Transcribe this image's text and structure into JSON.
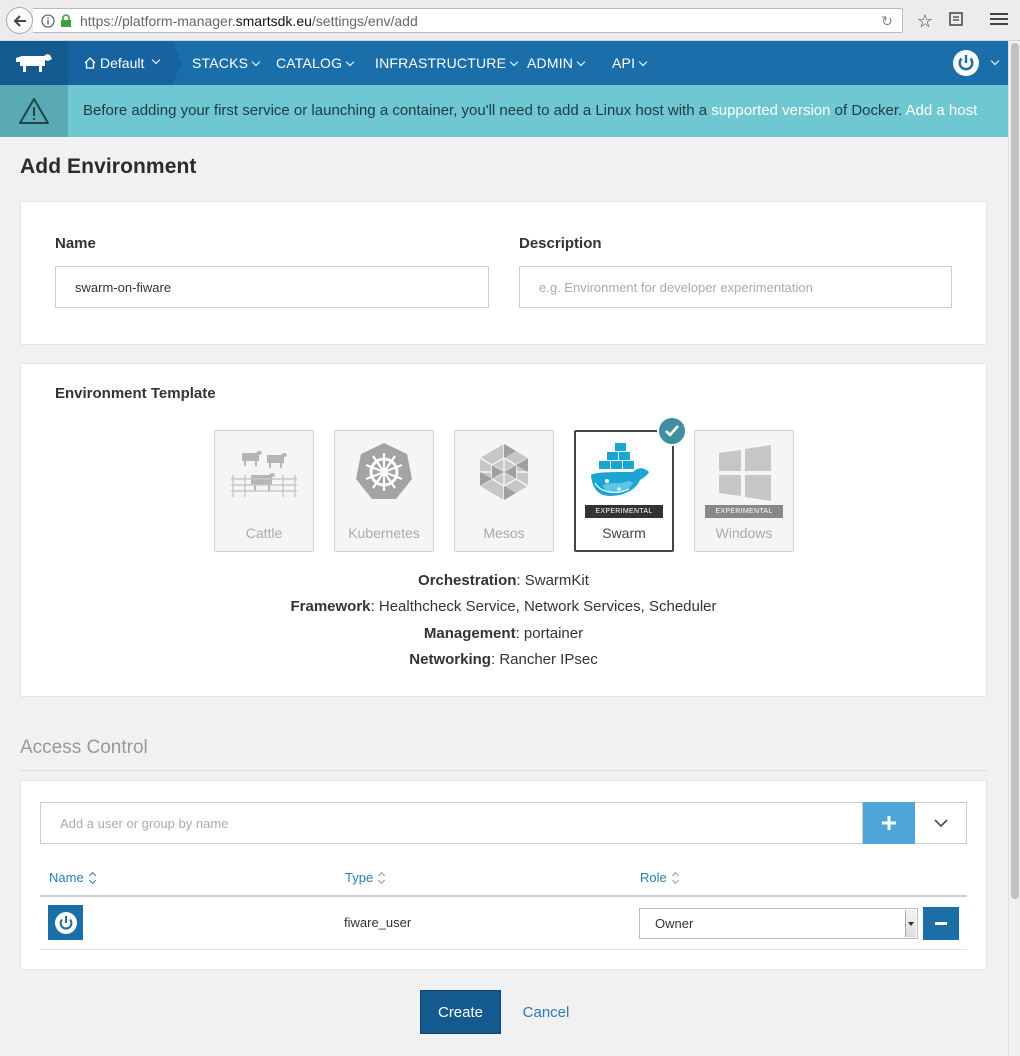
{
  "browser": {
    "url_prefix": "https://platform-manager.",
    "url_domain": "smartsdk.eu",
    "url_path": "/settings/env/add"
  },
  "header": {
    "env_label": "Default",
    "nav": [
      "STACKS",
      "CATALOG",
      "INFRASTRUCTURE",
      "ADMIN",
      "API"
    ]
  },
  "banner": {
    "text_before": "Before adding your first service or launching a container, you'll need to add a Linux host with a ",
    "link_supported": "supported version",
    "text_mid": " of Docker. ",
    "link_add_host": "Add a host"
  },
  "page": {
    "title": "Add Environment"
  },
  "form": {
    "name_label": "Name",
    "name_value": "swarm-on-fiware",
    "description_label": "Description",
    "description_placeholder": "e.g. Environment for developer experimentation"
  },
  "template": {
    "heading": "Environment Template",
    "tiles": [
      {
        "label": "Cattle",
        "badge": ""
      },
      {
        "label": "Kubernetes",
        "badge": ""
      },
      {
        "label": "Mesos",
        "badge": ""
      },
      {
        "label": "Swarm",
        "badge": "EXPERIMENTAL"
      },
      {
        "label": "Windows",
        "badge": "EXPERIMENTAL"
      }
    ],
    "selected": "Swarm",
    "details": [
      {
        "key": "Orchestration",
        "value": "SwarmKit"
      },
      {
        "key": "Framework",
        "value": "Healthcheck Service, Network Services, Scheduler"
      },
      {
        "key": "Management",
        "value": "portainer"
      },
      {
        "key": "Networking",
        "value": "Rancher IPsec"
      }
    ]
  },
  "access": {
    "heading": "Access Control",
    "search_placeholder": "Add a user or group by name",
    "columns": [
      "Name",
      "Type",
      "Role"
    ],
    "rows": [
      {
        "name": "",
        "type": "fiware_user",
        "role": "Owner"
      }
    ]
  },
  "actions": {
    "create": "Create",
    "cancel": "Cancel"
  },
  "colors": {
    "header_bg": "#1a6fab",
    "banner_bg": "#6fc7d1",
    "primary_button": "#145a8e",
    "check_badge": "#3f8fa1"
  }
}
